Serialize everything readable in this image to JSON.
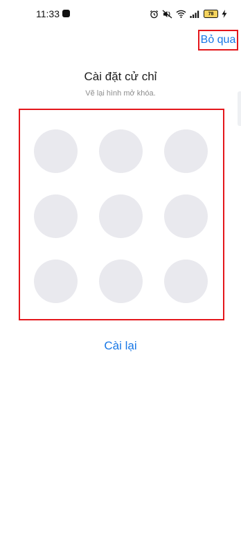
{
  "status_bar": {
    "time": "11:33",
    "battery": "78",
    "icons": [
      "alarm-icon",
      "mute-icon",
      "wifi-icon",
      "signal-icon",
      "battery-icon",
      "charging-icon"
    ]
  },
  "header": {
    "skip_label": "Bỏ qua"
  },
  "main": {
    "title": "Cài đặt cử chỉ",
    "subtitle": "Vẽ lại hình mở khóa.",
    "pattern_dots": 9,
    "reset_label": "Cài lại"
  },
  "colors": {
    "accent": "#1877e6",
    "highlight_border": "#e4161b",
    "dot": "#e9e9ee",
    "battery_fill": "#f4d35e"
  }
}
